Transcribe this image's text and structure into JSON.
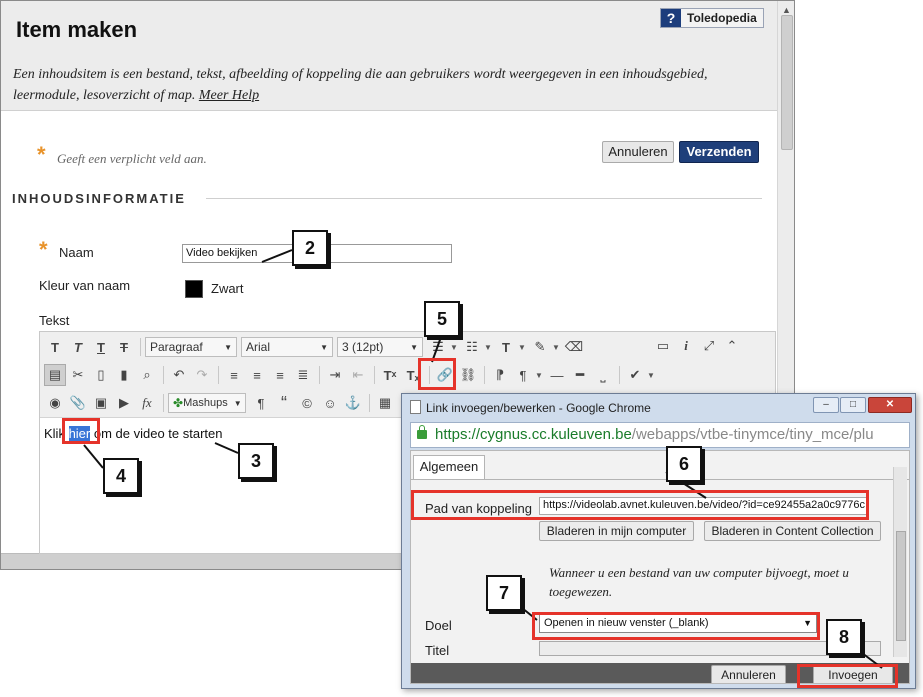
{
  "page": {
    "title": "Item maken",
    "help_button": {
      "icon": "?",
      "label": "Toledopedia"
    },
    "description": "Een inhoudsitem is een bestand, tekst, afbeelding of koppeling die aan gebruikers wordt weergegeven in een inhoudsgebied, leermodule, lesoverzicht of map.",
    "help_link": "Meer Help",
    "required_star": "*",
    "required_note": "Geeft een verplicht veld aan.",
    "cancel_button": "Annuleren",
    "submit_button": "Verzenden",
    "section_heading": "INHOUDSINFORMATIE"
  },
  "form": {
    "name_label": "Naam",
    "name_value": "Video bekijken",
    "color_label": "Kleur van naam",
    "color_value": "Zwart",
    "color_hex": "#000000",
    "text_label": "Tekst"
  },
  "editor": {
    "format_dropdown": "Paragraaf",
    "font_dropdown": "Arial",
    "size_dropdown": "3 (12pt)",
    "mashups_label": "Mashups",
    "body_before": "Klik ",
    "body_selected": "hier",
    "body_after": " om de video te starten",
    "icons": {
      "bold": "T",
      "italic": "T",
      "underline": "T",
      "strike": "T",
      "superscript": "Tˣ",
      "subscript": "Tₓ",
      "math": "fx",
      "paragraph": "¶",
      "quote": "“",
      "copyright": "©",
      "emoji": "☺",
      "anchor": "⚓",
      "info": "i"
    }
  },
  "popup": {
    "title": "Link invoegen/bewerken - Google Chrome",
    "url_host": "https://cygnus.cc.kuleuven.be",
    "url_path": "/webapps/vtbe-tinymce/tiny_mce/plu",
    "tab_label": "Algemeen",
    "link_label": "Pad van koppeling",
    "link_value": "https://videolab.avnet.kuleuven.be/video/?id=ce92455a2a0c9776c",
    "browse_computer": "Bladeren in mijn computer",
    "browse_collection": "Bladeren in Content Collection",
    "info_text": "Wanneer u een bestand van uw computer bijvoegt, moet u toegewezen.",
    "target_label": "Doel",
    "target_value": "Openen in nieuw venster (_blank)",
    "title_label": "Titel",
    "cancel_button": "Annuleren",
    "insert_button": "Invoegen",
    "window_controls": {
      "minimize": "–",
      "maximize": "□",
      "close": "✕"
    }
  },
  "annotations": {
    "callout_2": "2",
    "callout_3": "3",
    "callout_4": "4",
    "callout_5": "5",
    "callout_6": "6",
    "callout_7": "7",
    "callout_8": "8",
    "highlight_color": "#e5332a"
  }
}
